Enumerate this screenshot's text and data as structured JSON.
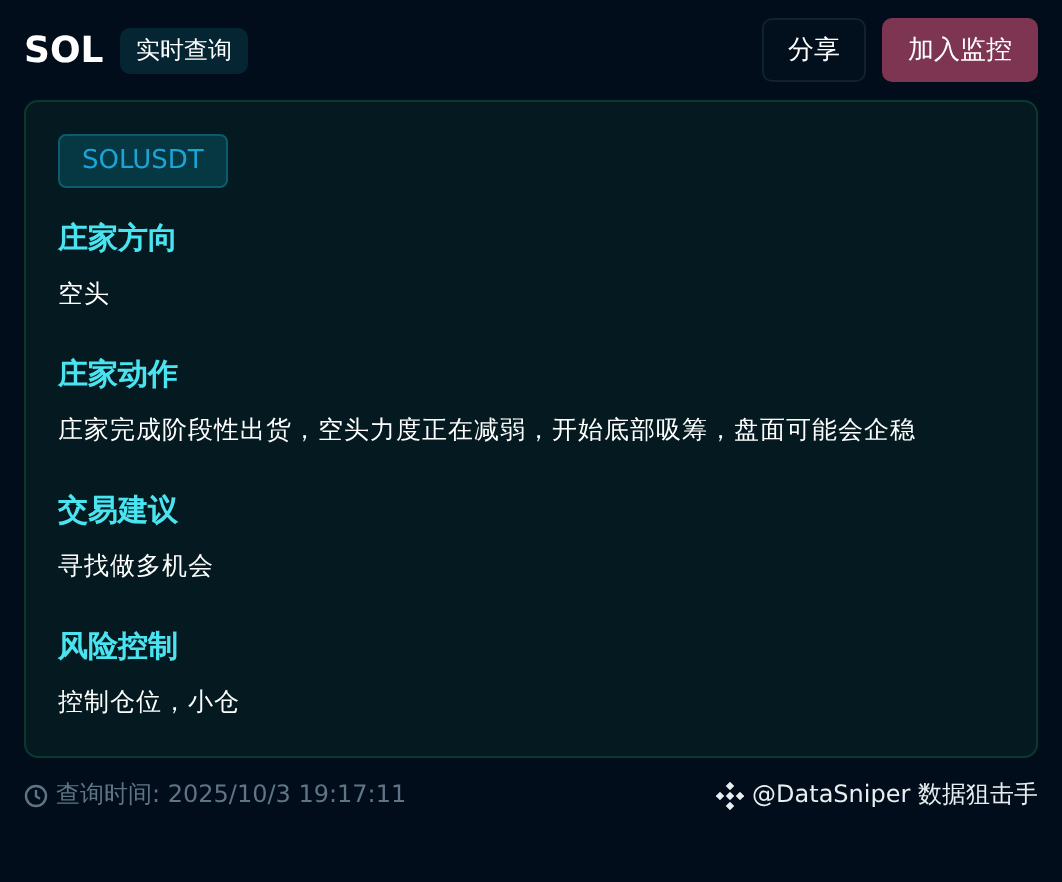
{
  "header": {
    "symbol": "SOL",
    "badge": "实时查询",
    "buttons": [
      {
        "label": "分享",
        "kind": "plain"
      },
      {
        "label": "加入监控",
        "kind": "primary"
      }
    ]
  },
  "card": {
    "pair": "SOLUSDT",
    "sections": [
      {
        "title": "庄家方向",
        "text": "空头"
      },
      {
        "title": "庄家动作",
        "text": "庄家完成阶段性出货，空头力度正在减弱，开始底部吸筹，盘面可能会企稳"
      },
      {
        "title": "交易建议",
        "text": "寻找做多机会"
      },
      {
        "title": "风险控制",
        "text": "控制仓位，小仓"
      }
    ]
  },
  "footer": {
    "query_time": "查询时间: 2025/10/3 19:17:11",
    "brand": "@DataSniper 数据狙击手"
  }
}
